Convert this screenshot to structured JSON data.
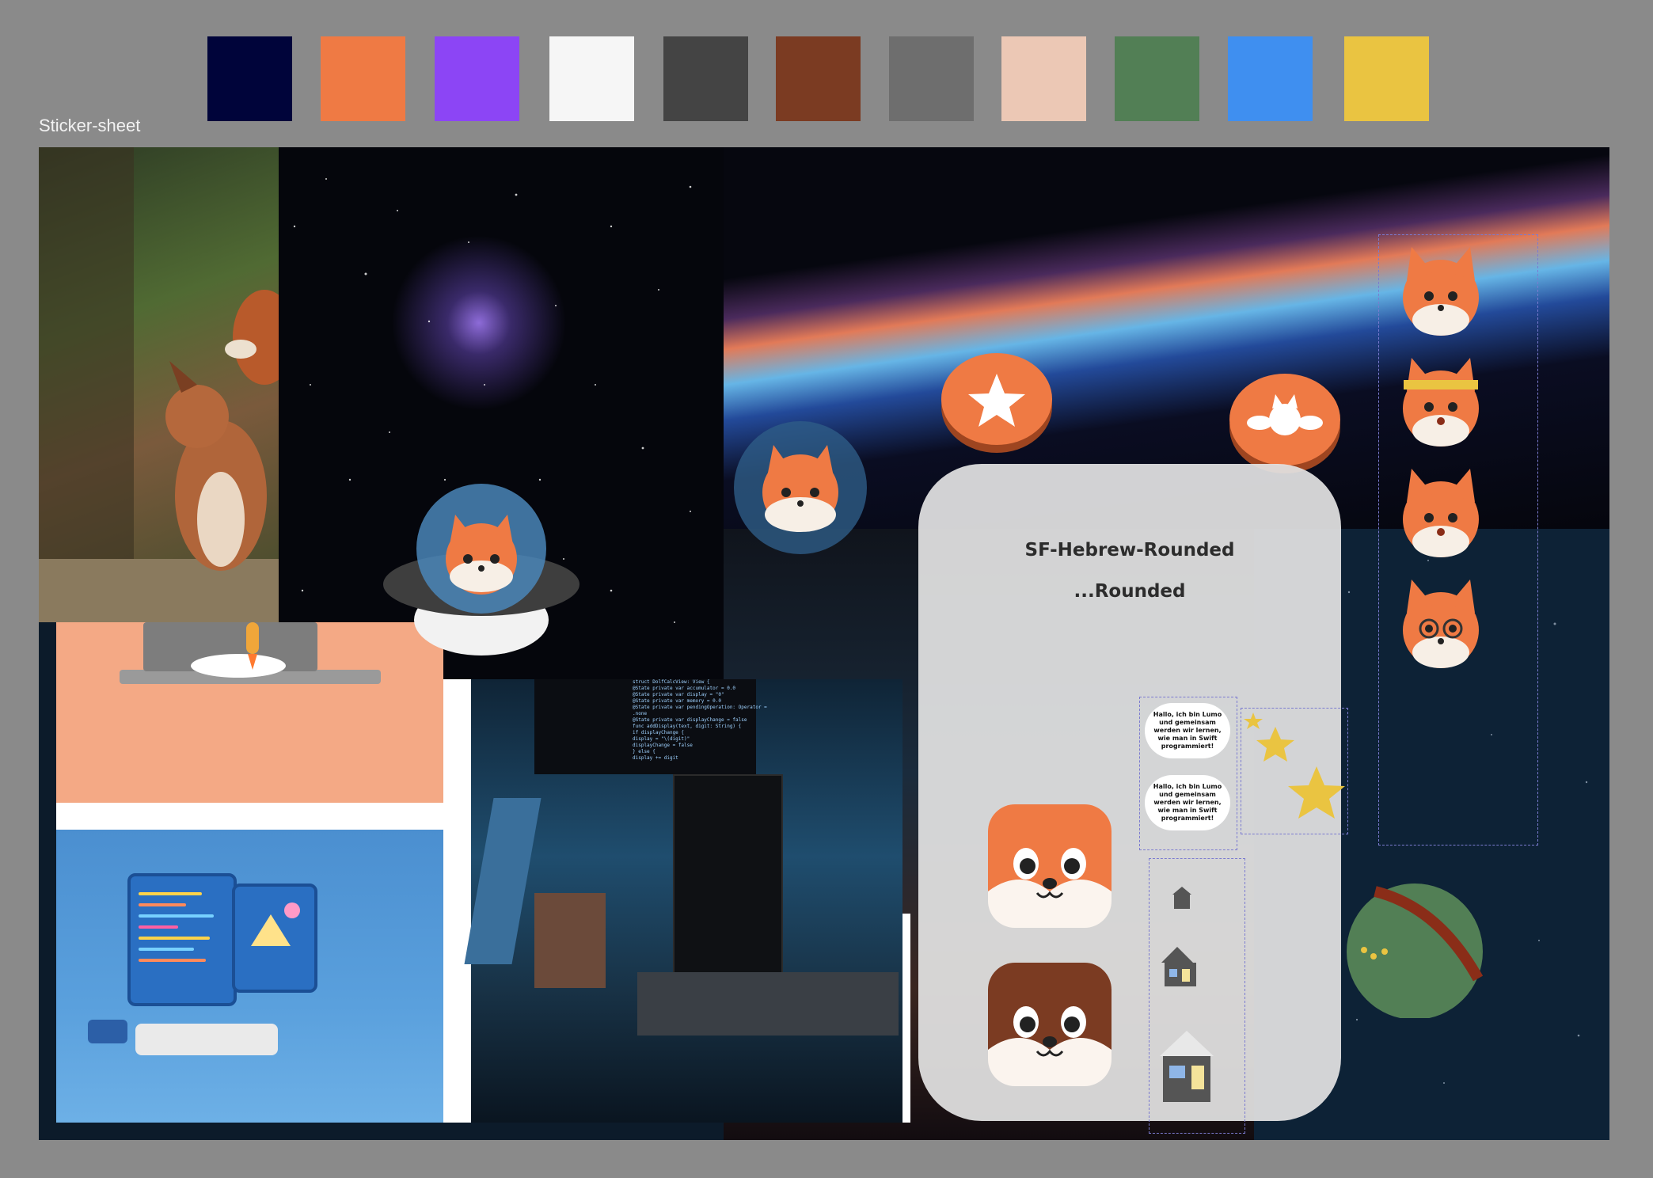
{
  "frame": {
    "label": "Sticker-sheet"
  },
  "palette": [
    {
      "name": "navy",
      "hex": "#00043a"
    },
    {
      "name": "orange",
      "hex": "#ef7a44"
    },
    {
      "name": "purple",
      "hex": "#8c45f5"
    },
    {
      "name": "white",
      "hex": "#f6f6f6"
    },
    {
      "name": "dark-gray",
      "hex": "#444444"
    },
    {
      "name": "brown",
      "hex": "#7b3b22"
    },
    {
      "name": "gray",
      "hex": "#6e6e6e"
    },
    {
      "name": "peach",
      "hex": "#ecc8b5"
    },
    {
      "name": "green",
      "hex": "#527f55"
    },
    {
      "name": "blue",
      "hex": "#3f8ff0"
    },
    {
      "name": "yellow",
      "hex": "#eac441"
    }
  ],
  "font_panel": {
    "title_1": "SF-Hebrew-Rounded",
    "title_2": "...Rounded"
  },
  "bubbles": [
    {
      "text": "Hallo, ich bin Lumo und gemeinsam werden wir lernen, wie man in Swift programmiert!"
    },
    {
      "text": "Hallo, ich bin Lumo und gemeinsam werden wir lernen, wie man in Swift programmiert!"
    }
  ],
  "code_lines": [
    "struct DolfCalcView: View {",
    "  @State private var accumulator = 0.0",
    "  @State private var display = \"0\"",
    "  @State private var memory = 0.0",
    "  @State private var pendingOperation: Operator = .none",
    "  @State private var displayChange = false",
    "  func addDisplay(text, digit: String) {",
    "    if displayChange {",
    "      display = \"\\(digit)\"",
    "      displayChange = false",
    "    } else {",
    "      display += digit"
  ],
  "icons": {
    "coin_1": "star-icon",
    "coin_2": "winged-cat-icon",
    "planet": "planet-icon",
    "rocket": "rocket-icon",
    "house": "house-icon"
  }
}
